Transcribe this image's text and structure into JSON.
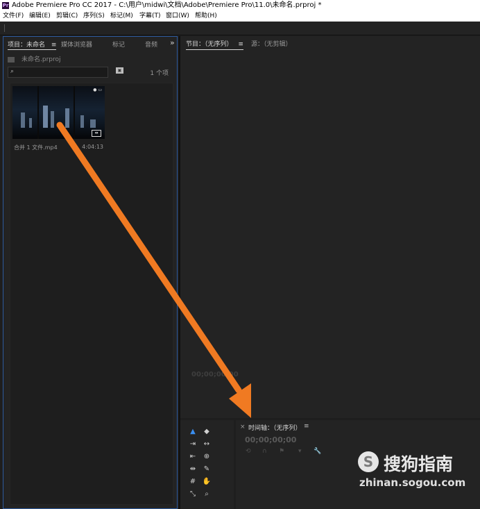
{
  "titlebar": {
    "app_icon": "Pr",
    "title": "Adobe Premiere Pro CC 2017 - C:\\用户\\midwi\\文档\\Adobe\\Premiere Pro\\11.0\\未命名.prproj *"
  },
  "menu": [
    "文件(F)",
    "编辑(E)",
    "剪辑(C)",
    "序列(S)",
    "标记(M)",
    "字幕(T)",
    "窗口(W)",
    "帮助(H)"
  ],
  "project_panel": {
    "tabs": [
      "项目：未命名",
      "媒体浏览器",
      "标记",
      "音频"
    ],
    "tab_menu_icon": "≡",
    "overflow_icon": "»",
    "project_file": "未命名.prproj",
    "search_placeholder": "",
    "item_count": "1 个项",
    "clip": {
      "name": "合并 1 文件.mp4",
      "duration": "4:04:13"
    }
  },
  "program_monitor": {
    "tab_program": "节目：（无序列）",
    "tab_menu_icon": "≡",
    "tab_source": "源：（无剪辑）",
    "timecode": "00;00;00;00"
  },
  "timeline": {
    "close_icon": "×",
    "title": "时间轴：（无序列）",
    "menu_icon": "≡",
    "timecode": "00;00;00;00"
  },
  "watermark": {
    "logo_letter": "S",
    "text": "搜狗指南",
    "url": "zhinan.sogou.com"
  },
  "colors": {
    "arrow": "#f07a22",
    "selection": "#2d5a9e",
    "tool_active": "#3a8ef0"
  }
}
